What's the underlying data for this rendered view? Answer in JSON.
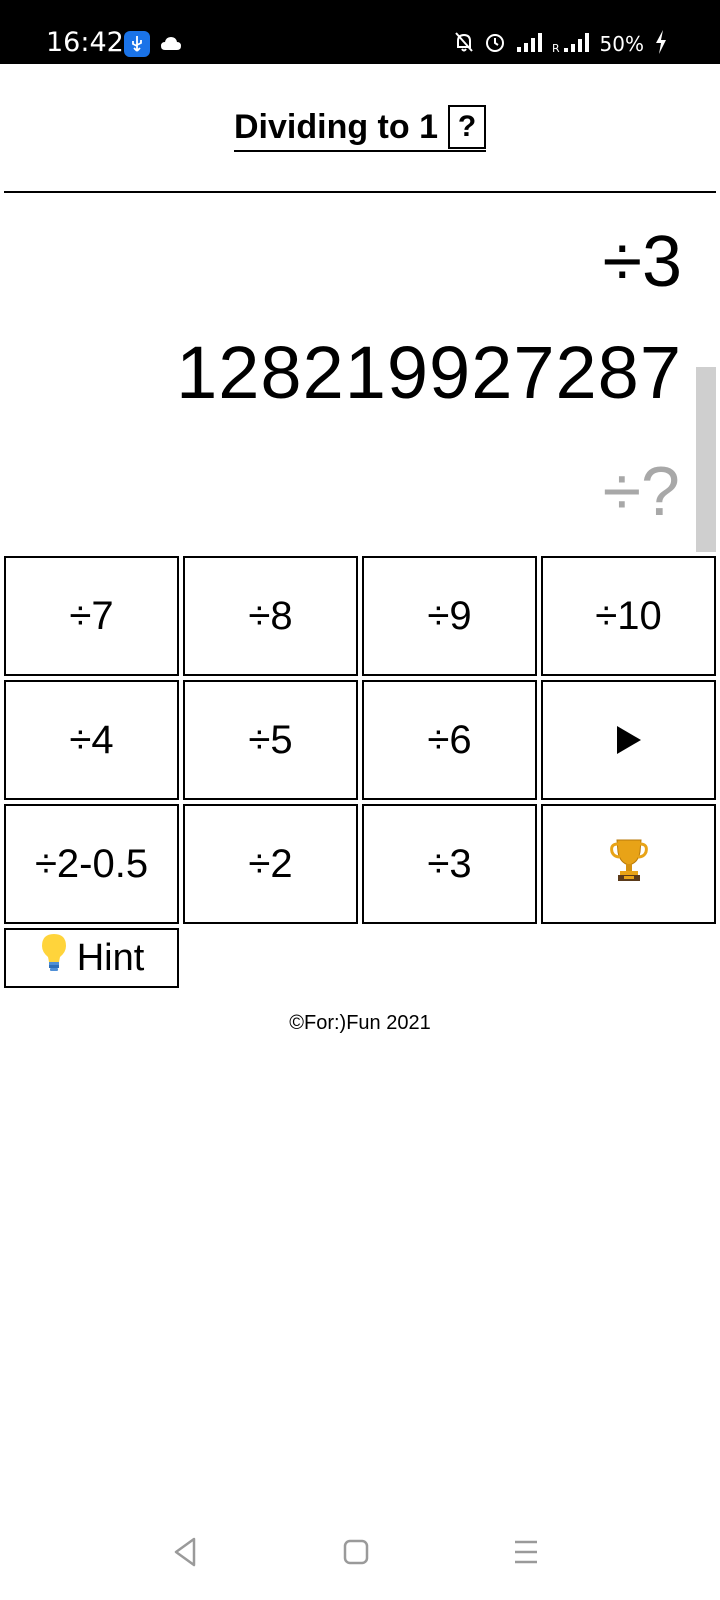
{
  "status_bar": {
    "time": "16:42",
    "battery": "50%",
    "icons": [
      "usb-icon",
      "cloud-icon",
      "bell-off-icon",
      "alarm-icon",
      "signal-icon",
      "roaming-signal-icon",
      "charging-icon"
    ]
  },
  "app": {
    "title": "Dividing to 1",
    "help_label": "?"
  },
  "equation": {
    "previous_operation": "÷3",
    "current_number": "128219927287",
    "next_operation": "÷?"
  },
  "keypad": {
    "rows": [
      [
        "÷7",
        "÷8",
        "÷9",
        "÷10"
      ],
      [
        "÷4",
        "÷5",
        "÷6",
        "play-icon"
      ],
      [
        "÷2-0.5",
        "÷2",
        "÷3",
        "trophy-icon"
      ]
    ]
  },
  "hint": {
    "label": "Hint",
    "icon": "lightbulb-icon"
  },
  "footer": {
    "copyright": "©For:)Fun 2021"
  },
  "colors": {
    "accent_usb": "#1a73e8",
    "muted_text": "#a8a8a8"
  }
}
